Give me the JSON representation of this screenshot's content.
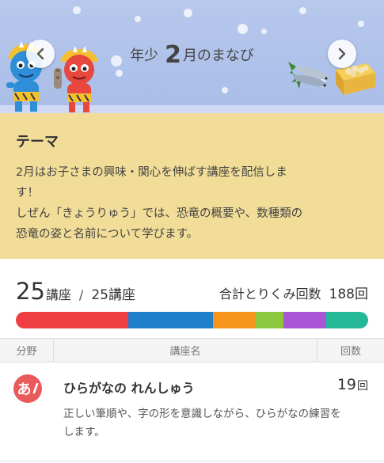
{
  "banner": {
    "grade": "年少",
    "month_number": "2",
    "month_suffix": "月のまなび",
    "prev_icon": "chevron-left-icon",
    "next_icon": "chevron-right-icon"
  },
  "theme": {
    "heading": "テーマ",
    "lines": [
      "2月はお子さまの興味・関心を伸ばす講座を配信しま",
      "す！",
      "しぜん「きょうりゅう」では、恐竜の概要や、数種類の",
      "恐竜の姿と名前について学びます。"
    ]
  },
  "summary": {
    "completed": "25",
    "unit": "講座",
    "separator": "/",
    "total": "25講座",
    "total_label": "合計とりくみ回数",
    "total_value": "188回"
  },
  "progress_segments": [
    {
      "color": "#ef3e42",
      "fraction": 0.32
    },
    {
      "color": "#1e7fcb",
      "fraction": 0.24
    },
    {
      "color": "#f7941d",
      "fraction": 0.12
    },
    {
      "color": "#8dc63f",
      "fraction": 0.08
    },
    {
      "color": "#a855d6",
      "fraction": 0.12
    },
    {
      "color": "#24b899",
      "fraction": 0.12
    }
  ],
  "table": {
    "headers": {
      "field": "分野",
      "name": "講座名",
      "count": "回数"
    }
  },
  "courses": [
    {
      "icon_text": "あ",
      "icon": "hiragana-pencil-icon",
      "title": "ひらがなの れんしゅう",
      "count": "19",
      "count_unit": "回",
      "desc_lines": [
        "正しい筆順や、字の形を意識しながら、ひらがなの練習を",
        "します。"
      ]
    }
  ],
  "colors": {
    "banner_bg": "#b7c8ec",
    "theme_bg": "#f1dd97",
    "accent_red": "#ea5a5d"
  }
}
